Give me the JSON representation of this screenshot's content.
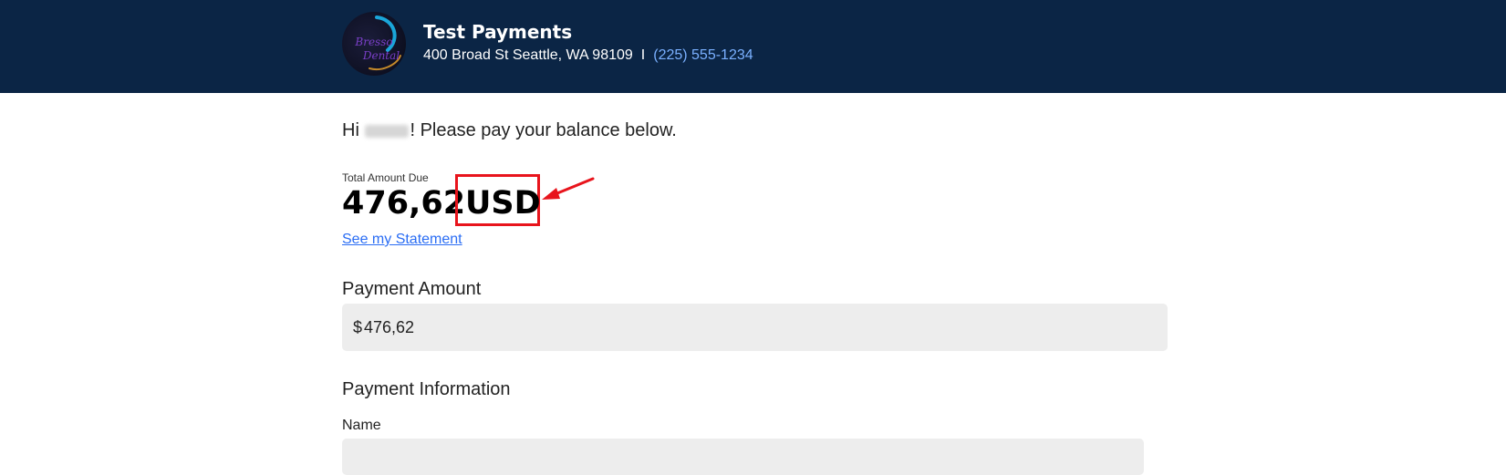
{
  "header": {
    "practice_name": "Test Payments",
    "address": "400 Broad St Seattle, WA 98109",
    "separator": "I",
    "phone": "(225) 555-1234",
    "logo_text_line1": "Bresso",
    "logo_text_line2": "Dental"
  },
  "greeting": {
    "prefix": "Hi",
    "suffix": "! Please pay your balance below."
  },
  "balance": {
    "label": "Total Amount Due",
    "amount": "476,62",
    "currency": "USD",
    "statement_link": "See my Statement"
  },
  "payment_amount": {
    "title": "Payment Amount",
    "currency_symbol": "$",
    "value": "476,62"
  },
  "payment_information": {
    "title": "Payment Information",
    "name_label": "Name"
  },
  "colors": {
    "header_bg": "#0b2545",
    "link": "#2a6df4",
    "phone_link": "#7ab0ff",
    "highlight": "#e8141c",
    "field_bg": "#ededed"
  },
  "icons": {
    "annotation": "red-arrow-icon"
  }
}
